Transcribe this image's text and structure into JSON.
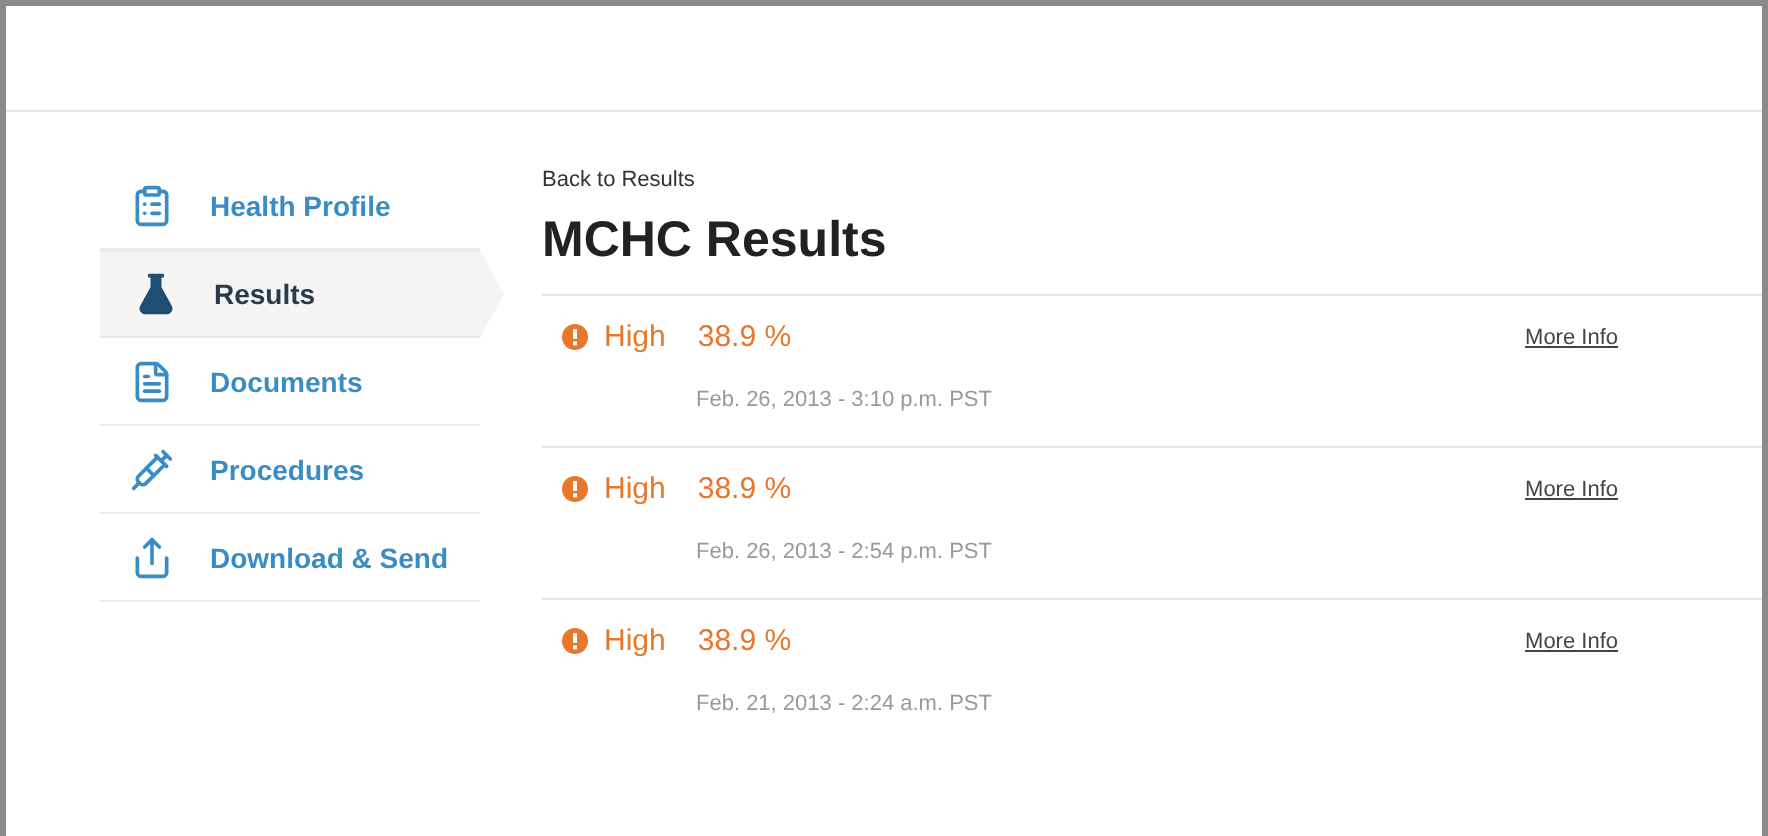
{
  "sidebar": {
    "items": [
      {
        "label": "Health Profile",
        "kind": "profile",
        "selected": false
      },
      {
        "label": "Results",
        "kind": "results",
        "selected": true
      },
      {
        "label": "Documents",
        "kind": "documents",
        "selected": false
      },
      {
        "label": "Procedures",
        "kind": "procedures",
        "selected": false
      },
      {
        "label": "Download & Send",
        "kind": "share",
        "selected": false
      }
    ]
  },
  "back_link": "Back to Results",
  "title": "MCHC Results",
  "results": [
    {
      "flag": "High",
      "value": "38.9 %",
      "date": "Feb. 26, 2013 - 3:10 p.m. PST",
      "link": "More Info"
    },
    {
      "flag": "High",
      "value": "38.9 %",
      "date": "Feb. 26, 2013 - 2:54 p.m. PST",
      "link": "More Info"
    },
    {
      "flag": "High",
      "value": "38.9 %",
      "date": "Feb. 21, 2013 - 2:24 a.m. PST",
      "link": "More Info"
    }
  ]
}
